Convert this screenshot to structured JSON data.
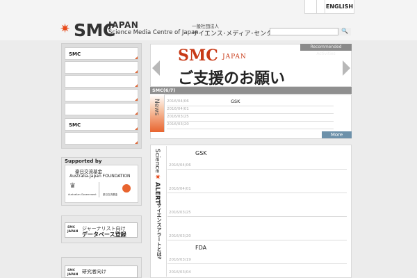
{
  "header": {
    "lang_en": "ENGLISH",
    "logo_smc": "SMC",
    "logo_japan": "JAPAN",
    "logo_sub": "Science Media Centre of Japan",
    "logo_ja_small": "一般社団法人",
    "logo_ja": "サイエンス･メディア･センター"
  },
  "sidebar": {
    "items": [
      {
        "label": "SMC"
      },
      {
        "label": ""
      },
      {
        "label": ""
      },
      {
        "label": ""
      },
      {
        "label": ""
      },
      {
        "label": "SMC"
      },
      {
        "label": ""
      }
    ],
    "support_title": "Supported by",
    "support_org1": "豪日交流基金",
    "support_org2": "Australia-Japan FOUNDATION",
    "support_gov": "Australian Government",
    "support_org3": "豪日交流基金",
    "db1_line1": "ジャーナリスト向け",
    "db1_line2": "データベース登録",
    "db2_line1": "研究者向け"
  },
  "banner": {
    "label": "Recommended Activities",
    "smc": "SMC",
    "japan": "JAPAN",
    "title": "ご支援のお願い"
  },
  "news": {
    "header": "SMC(6/7)",
    "side_label": "News",
    "rows": [
      {
        "date": "2016/04/06",
        "title": "GSK"
      },
      {
        "date": "2016/04/01",
        "title": ""
      },
      {
        "date": "2016/03/25",
        "title": ""
      },
      {
        "date": "2016/03/20",
        "title": ""
      }
    ],
    "more": "More"
  },
  "alert": {
    "side_label_top": "Science",
    "side_label_bottom": "ALERT",
    "sub_label": "サイエンスアラートとは?",
    "rows": [
      {
        "date": "2016/04/06",
        "title": "GSK"
      },
      {
        "date": "2016/04/01",
        "title": ""
      },
      {
        "date": "2016/03/25",
        "title": ""
      },
      {
        "date": "2016/03/20",
        "title": ""
      },
      {
        "date": "2016/03/19",
        "title": "FDA"
      },
      {
        "date": "2016/03/04",
        "title": ""
      }
    ]
  },
  "icons": {
    "logo_star": "✷",
    "search": "🔍",
    "alert_star": "✷"
  },
  "colors": {
    "accent": "#e84a1a",
    "more_button": "#6d91aa",
    "panel_header": "#8f8f8f"
  }
}
